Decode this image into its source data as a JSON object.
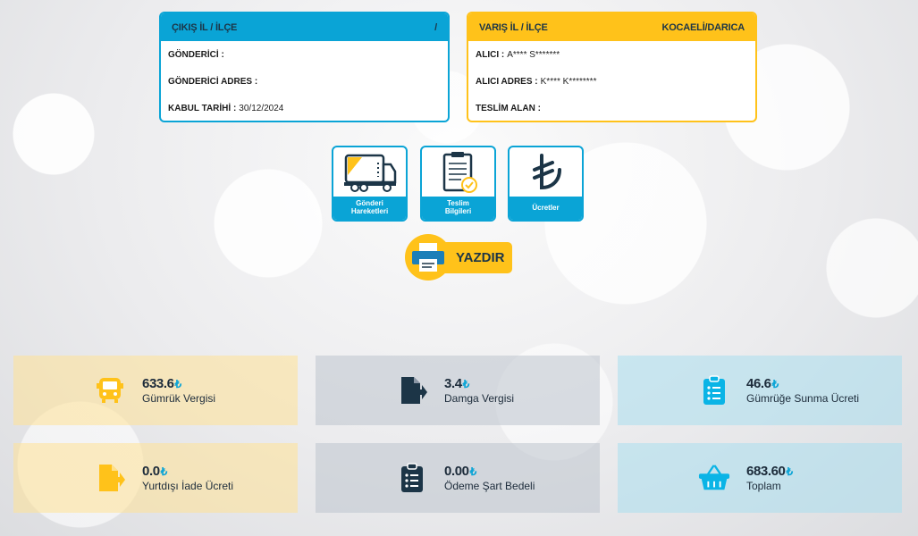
{
  "origin": {
    "title": "ÇIKIŞ İL / İLÇE",
    "location": "/",
    "rows": [
      {
        "label": "GÖNDERİCİ :",
        "value": ""
      },
      {
        "label": "GÖNDERİCİ ADRES :",
        "value": ""
      },
      {
        "label": "KABUL TARİHİ :",
        "value": "30/12/2024"
      }
    ]
  },
  "destination": {
    "title": "VARIŞ İL / İLÇE",
    "location": "KOCAELİ/DARICA",
    "rows": [
      {
        "label": "ALICI :",
        "value": "A**** S*******"
      },
      {
        "label": "ALICI ADRES :",
        "value": "K**** K********"
      },
      {
        "label": "TESLİM ALAN :",
        "value": ""
      }
    ]
  },
  "tiles": [
    {
      "label_line1": "Gönderi",
      "label_line2": "Hareketleri",
      "icon": "truck-icon"
    },
    {
      "label_line1": "Teslim",
      "label_line2": "Bilgileri",
      "icon": "clipboard-check-icon"
    },
    {
      "label_line1": "Ücretler",
      "label_line2": "",
      "icon": "lira-icon"
    }
  ],
  "print": {
    "label": "YAZDIR",
    "icon": "printer-icon"
  },
  "currency_symbol": "₺",
  "stats": [
    {
      "value": "633.6",
      "name": "Gümrük Vergisi",
      "icon": "bus-icon",
      "color": "#ffc21a"
    },
    {
      "value": "3.4",
      "name": "Damga Vergisi",
      "icon": "file-export-icon",
      "color": "#1c3547"
    },
    {
      "value": "46.6",
      "name": "Gümrüğe Sunma Ücreti",
      "icon": "clipboard-list-icon",
      "color": "#0ab4e6"
    },
    {
      "value": "0.0",
      "name": "Yurtdışı İade Ücreti",
      "icon": "file-export-icon",
      "color": "#ffc21a"
    },
    {
      "value": "0.00",
      "name": "Ödeme Şart Bedeli",
      "icon": "clipboard-list-icon",
      "color": "#1c3547"
    },
    {
      "value": "683.60",
      "name": "Toplam",
      "icon": "basket-icon",
      "color": "#0ab4e6"
    }
  ],
  "colors": {
    "blue": "#0aa4d6",
    "yellow": "#ffc21a",
    "navy": "#1c3547"
  }
}
